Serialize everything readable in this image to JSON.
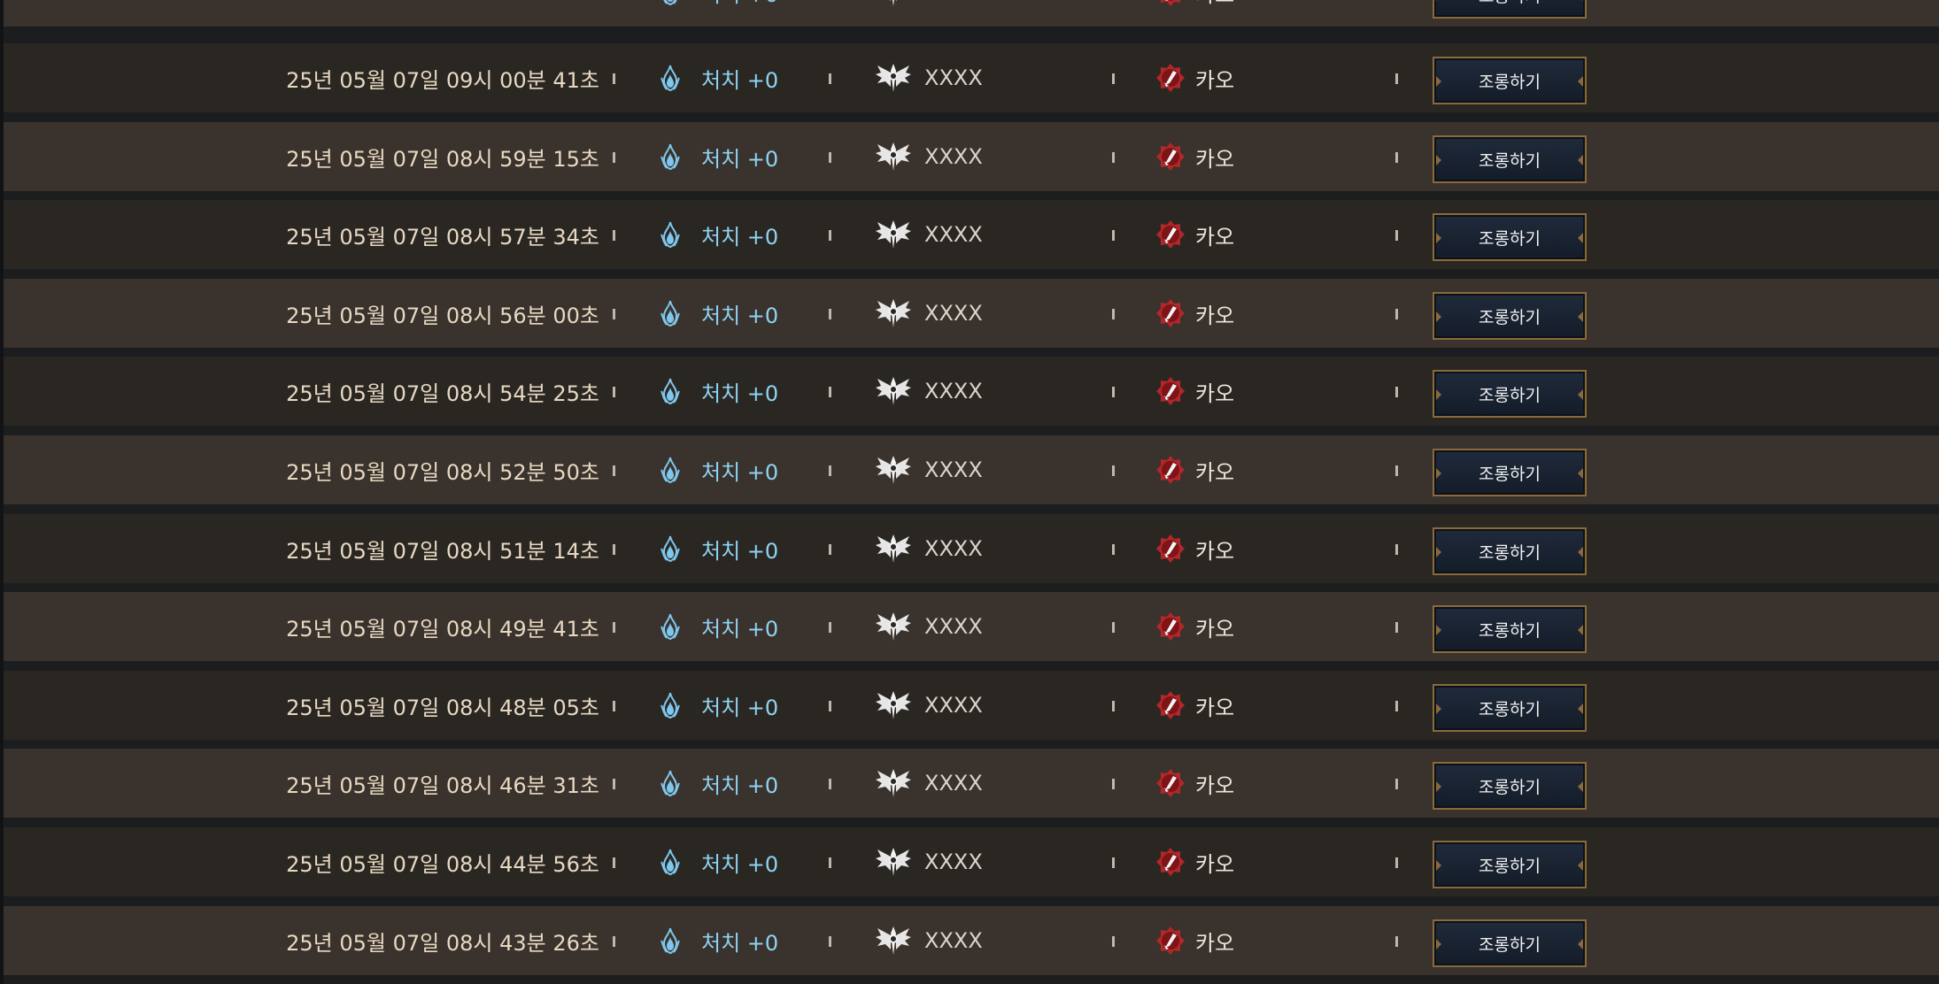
{
  "kill_label": "처치 +0",
  "player_name": "XXXX",
  "class_name": "카오",
  "taunt_label": "조롱하기",
  "icons": {
    "kill": "blue-crystal-flame-icon",
    "rank": "winged-crest-icon",
    "class": "red-blade-emblem-icon"
  },
  "colors": {
    "row_dark": "#2a2723",
    "row_light": "#3a322c",
    "time_text": "#e7d8c1",
    "kill_text": "#8fd2f2",
    "button_bg": "#1a2332",
    "button_border": "#8a6a3a"
  },
  "rows": [
    {
      "time": "25년 05월 07일 09시 00분 41초"
    },
    {
      "time": "25년 05월 07일 08시 59분 15초"
    },
    {
      "time": "25년 05월 07일 08시 57분 34초"
    },
    {
      "time": "25년 05월 07일 08시 56분 00초"
    },
    {
      "time": "25년 05월 07일 08시 54분 25초"
    },
    {
      "time": "25년 05월 07일 08시 52분 50초"
    },
    {
      "time": "25년 05월 07일 08시 51분 14초"
    },
    {
      "time": "25년 05월 07일 08시 49분 41초"
    },
    {
      "time": "25년 05월 07일 08시 48분 05초"
    },
    {
      "time": "25년 05월 07일 08시 46분 31초"
    },
    {
      "time": "25년 05월 07일 08시 44분 56초"
    },
    {
      "time": "25년 05월 07일 08시 43분 26초"
    }
  ]
}
